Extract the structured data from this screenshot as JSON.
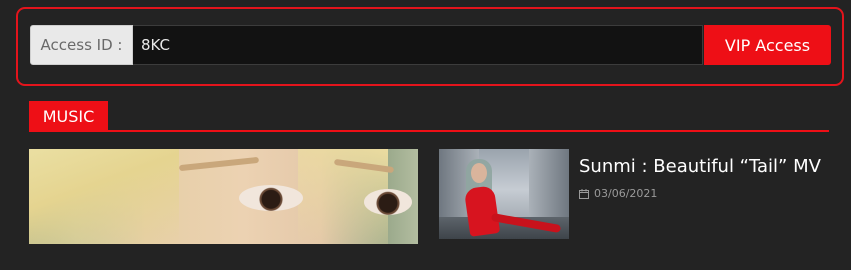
{
  "access": {
    "label": "Access ID :",
    "value": "8KC",
    "button_label": "VIP Access"
  },
  "section": {
    "title": "MUSIC"
  },
  "posts": [
    {
      "title": "Sunmi : Beautiful “Tail” MV",
      "date": "03/06/2021",
      "icon": "calendar-icon"
    }
  ],
  "colors": {
    "accent": "#ee0f16",
    "background": "#232323"
  }
}
